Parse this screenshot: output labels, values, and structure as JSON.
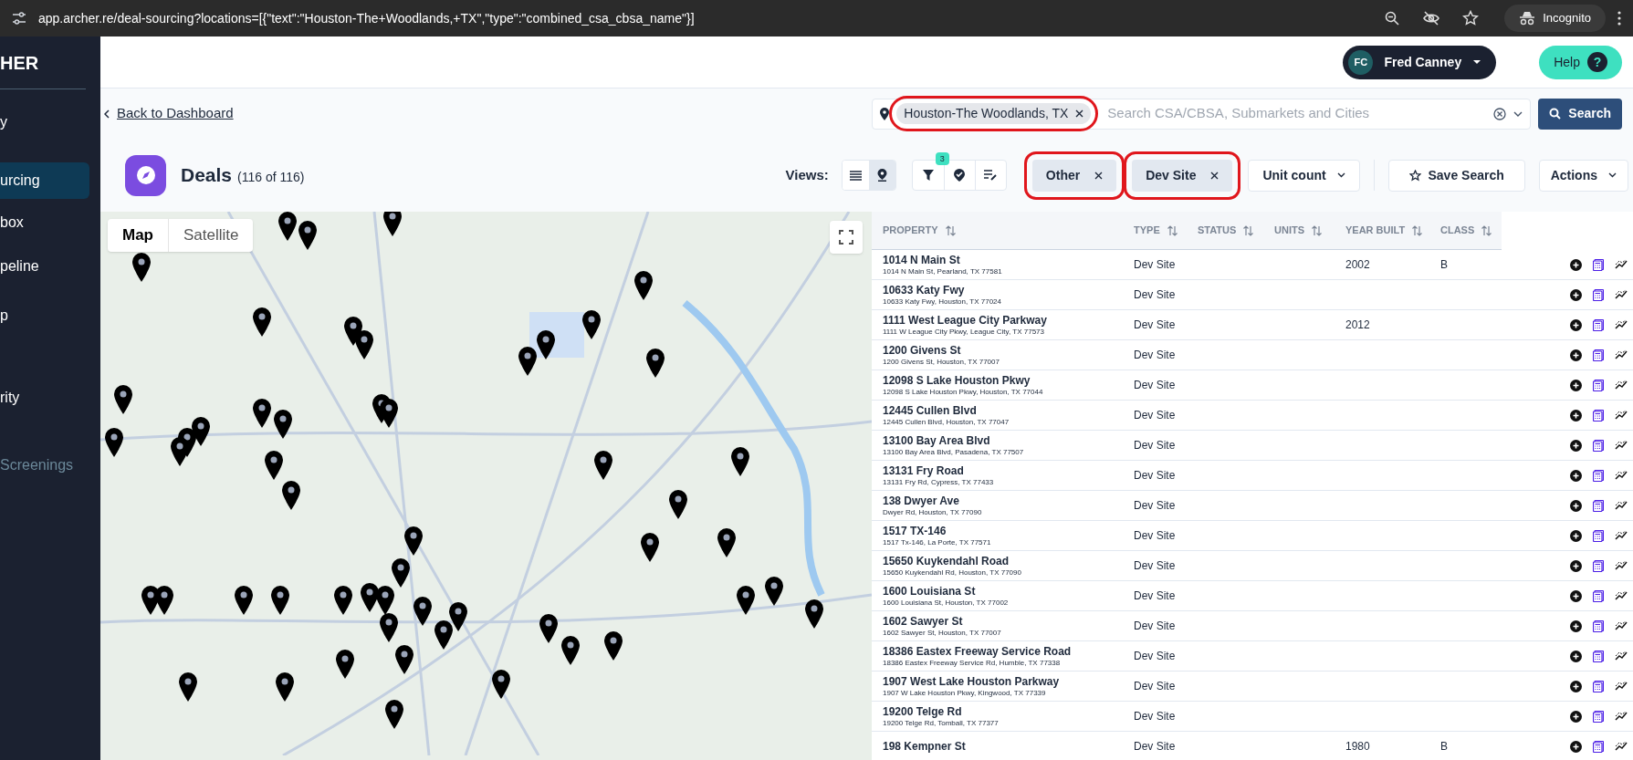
{
  "browser": {
    "url": "app.archer.re/deal-sourcing?locations=[{\"text\":\"Houston-The+Woodlands,+TX\",\"type\":\"combined_csa_cbsa_name\"}]",
    "profile": "Incognito"
  },
  "sidebar": {
    "logo": "HER",
    "items": [
      {
        "label": "y",
        "selected": false,
        "disabled": false
      },
      {
        "label": "urcing",
        "selected": true,
        "disabled": false
      },
      {
        "label": "box",
        "selected": false,
        "disabled": false
      },
      {
        "label": "peline",
        "selected": false,
        "disabled": false
      },
      {
        "label": "p",
        "selected": false,
        "disabled": false
      },
      {
        "label": "rity",
        "selected": false,
        "disabled": false
      },
      {
        "label": "Screenings",
        "selected": false,
        "disabled": true
      }
    ]
  },
  "header": {
    "user": {
      "initials": "FC",
      "name": "Fred Canney"
    },
    "help": "Help",
    "help_icon": "?"
  },
  "back_link": "Back to Dashboard",
  "search": {
    "chip": {
      "label": "Houston-The Woodlands, TX",
      "highlighted": true
    },
    "placeholder": "Search CSA/CBSA, Submarkets and Cities",
    "button": "Search"
  },
  "deals": {
    "title": "Deals",
    "count": "(116 of 116)"
  },
  "views": {
    "label": "Views:",
    "options": [
      {
        "kind": "list",
        "selected": false
      },
      {
        "kind": "map",
        "selected": true
      }
    ]
  },
  "filter_badge": "3",
  "filter_chips": [
    {
      "label": "Other",
      "highlighted": true
    },
    {
      "label": "Dev Site",
      "highlighted": true
    }
  ],
  "unit_count": "Unit count",
  "save_search": "Save Search",
  "actions": "Actions",
  "map": {
    "tabs": [
      {
        "label": "Map",
        "selected": true
      },
      {
        "label": "Satellite",
        "selected": false
      }
    ]
  },
  "table": {
    "columns": [
      "PROPERTY",
      "TYPE",
      "STATUS",
      "UNITS",
      "YEAR BUILT",
      "CLASS"
    ],
    "rows": [
      {
        "name": "1014 N Main St",
        "address": "1014 N Main St, Pearland, TX 77581",
        "type": "Dev Site",
        "year_built": "2002",
        "class": "B"
      },
      {
        "name": "10633 Katy Fwy",
        "address": "10633 Katy Fwy, Houston, TX 77024",
        "type": "Dev Site"
      },
      {
        "name": "1111 West League City Parkway",
        "address": "1111 W League City Pkwy, League City, TX 77573",
        "type": "Dev Site",
        "year_built": "2012"
      },
      {
        "name": "1200 Givens St",
        "address": "1200 Givens St, Houston, TX 77007",
        "type": "Dev Site"
      },
      {
        "name": "12098 S Lake Houston Pkwy",
        "address": "12098 S Lake Houston Pkwy, Houston, TX 77044",
        "type": "Dev Site"
      },
      {
        "name": "12445 Cullen Blvd",
        "address": "12445 Cullen Blvd, Houston, TX 77047",
        "type": "Dev Site"
      },
      {
        "name": "13100 Bay Area Blvd",
        "address": "13100 Bay Area Blvd, Pasadena, TX 77507",
        "type": "Dev Site"
      },
      {
        "name": "13131 Fry Road",
        "address": "13131 Fry Rd, Cypress, TX 77433",
        "type": "Dev Site"
      },
      {
        "name": "138 Dwyer Ave",
        "address": "Dwyer Rd, Houston, TX 77090",
        "type": "Dev Site"
      },
      {
        "name": "1517 TX-146",
        "address": "1517 Tx-146, La Porte, TX 77571",
        "type": "Dev Site"
      },
      {
        "name": "15650 Kuykendahl Road",
        "address": "15650 Kuykendahl Rd, Houston, TX 77090",
        "type": "Dev Site"
      },
      {
        "name": "1600 Louisiana St",
        "address": "1600 Louisiana St, Houston, TX 77002",
        "type": "Dev Site"
      },
      {
        "name": "1602 Sawyer St",
        "address": "1602 Sawyer St, Houston, TX 77007",
        "type": "Dev Site"
      },
      {
        "name": "18386 Eastex Freeway Service Road",
        "address": "18386 Eastex Freeway Service Rd, Humble, TX 77338",
        "type": "Dev Site"
      },
      {
        "name": "1907 West Lake Houston Parkway",
        "address": "1907 W Lake Houston Pkwy, Kingwood, TX 77339",
        "type": "Dev Site"
      },
      {
        "name": "19200 Telge Rd",
        "address": "19200 Telge Rd, Tomball, TX 77377",
        "type": "Dev Site"
      },
      {
        "name": "198 Kempner St",
        "type": "Dev Site",
        "year_built": "1980",
        "class": "B"
      }
    ]
  }
}
